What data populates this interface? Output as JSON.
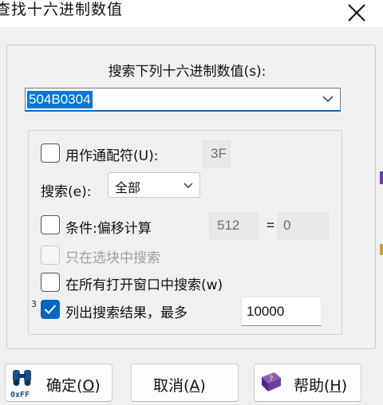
{
  "window": {
    "title": "查找十六进制数值",
    "close_glyph": "✕"
  },
  "search": {
    "label": "搜索下列十六进制数值(s):",
    "value": "504B0304"
  },
  "options": {
    "wildcard": {
      "label": "用作通配符(U):",
      "value": "3F",
      "checked": false
    },
    "search_scope": {
      "label": "搜索(e):",
      "selected": "全部"
    },
    "condition": {
      "label": "条件:偏移计算",
      "value": "512",
      "equals": "=",
      "result": "0",
      "checked": false
    },
    "in_block": {
      "label": "只在选块中搜索",
      "checked": false,
      "enabled": false
    },
    "all_windows": {
      "label": "在所有打开窗口中搜索(w)",
      "checked": false
    },
    "list_results": {
      "prefix": "3",
      "label": "列出搜索结果，最多",
      "value": "10000",
      "checked": true
    }
  },
  "buttons": {
    "ok": {
      "text": "确定(",
      "key": "O",
      "close": ")",
      "icon_text": "0xFF"
    },
    "cancel": {
      "text": "取消(",
      "key": "A",
      "close": ")"
    },
    "help": {
      "text": "帮助(",
      "key": "H",
      "close": ")",
      "icon_text": "?"
    }
  },
  "colors": {
    "accent": "#0067c0",
    "selection": "#0078d7",
    "help_icon": "#6b3fa0"
  }
}
